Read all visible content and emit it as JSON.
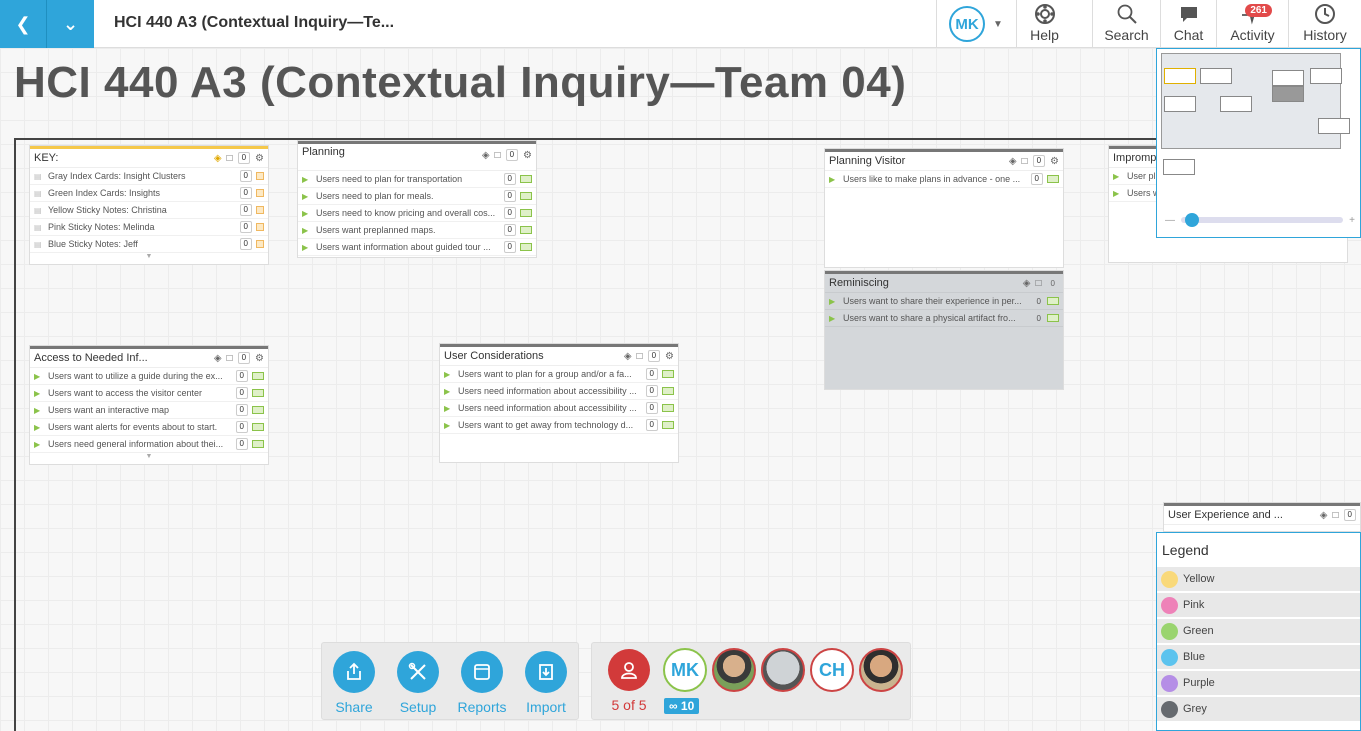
{
  "topbar": {
    "doc_title": "HCI 440 A3 (Contextual Inquiry—Te...",
    "user_initials": "MK",
    "tools": [
      {
        "label": "Help",
        "icon": "lifebuoy-icon"
      },
      {
        "label": "Search",
        "icon": "search-icon"
      },
      {
        "label": "Chat",
        "icon": "chat-icon"
      },
      {
        "label": "Activity",
        "icon": "activity-icon",
        "badge": "261"
      },
      {
        "label": "History",
        "icon": "history-icon"
      }
    ]
  },
  "page_title": "HCI 440 A3 (Contextual Inquiry—Team 04)",
  "cards": {
    "key": {
      "title": "KEY:",
      "count": "0",
      "rows": [
        {
          "text": "Gray Index Cards: Insight Clusters",
          "count": "0"
        },
        {
          "text": "Green Index Cards: Insights",
          "count": "0"
        },
        {
          "text": "Yellow Sticky Notes: Christina",
          "count": "0"
        },
        {
          "text": "Pink Sticky Notes: Melinda",
          "count": "0"
        },
        {
          "text": "Blue Sticky Notes: Jeff",
          "count": "0"
        }
      ]
    },
    "planning": {
      "title": "Planning",
      "count": "0",
      "rows": [
        {
          "text": "Users need to plan for transportation",
          "count": "0"
        },
        {
          "text": "Users need to plan for meals.",
          "count": "0"
        },
        {
          "text": "Users need to know pricing and overall cos...",
          "count": "0"
        },
        {
          "text": "Users want preplanned maps.",
          "count": "0"
        },
        {
          "text": "Users want information about guided tour ...",
          "count": "0"
        }
      ]
    },
    "planning_visitor": {
      "title": "Planning Visitor",
      "count": "0",
      "rows": [
        {
          "text": "Users like to make plans in advance - one ...",
          "count": "0"
        }
      ]
    },
    "impromptu": {
      "title": "Impromp",
      "rows": [
        {
          "text": "User pl"
        },
        {
          "text": "Users w"
        }
      ]
    },
    "reminiscing": {
      "title": "Reminiscing",
      "count": "0",
      "rows": [
        {
          "text": "Users want to share their experience in per...",
          "count": "0"
        },
        {
          "text": "Users want to share a physical artifact fro...",
          "count": "0"
        }
      ]
    },
    "access": {
      "title": "Access to Needed Inf...",
      "count": "0",
      "rows": [
        {
          "text": "Users want to utilize a guide during the ex...",
          "count": "0"
        },
        {
          "text": "Users want to access the visitor center",
          "count": "0"
        },
        {
          "text": "Users want an interactive map",
          "count": "0"
        },
        {
          "text": "Users want alerts for events about to start.",
          "count": "0"
        },
        {
          "text": "Users need general information about thei...",
          "count": "0"
        }
      ]
    },
    "user_considerations": {
      "title": "User Considerations",
      "count": "0",
      "rows": [
        {
          "text": "Users want to plan for a group and/or a fa...",
          "count": "0"
        },
        {
          "text": "Users need information about accessibility ...",
          "count": "0"
        },
        {
          "text": "Users need information about accessibility ...",
          "count": "0"
        },
        {
          "text": "Users want to get away from technology d...",
          "count": "0"
        }
      ]
    },
    "user_experience": {
      "title": "User Experience and ...",
      "count": "0"
    }
  },
  "legend": {
    "title": "Legend",
    "items": [
      {
        "label": "Yellow",
        "color": "#f9d97a"
      },
      {
        "label": "Pink",
        "color": "#ee82b8"
      },
      {
        "label": "Green",
        "color": "#9ad46f"
      },
      {
        "label": "Blue",
        "color": "#5cc3ee"
      },
      {
        "label": "Purple",
        "color": "#b58ee6"
      },
      {
        "label": "Grey",
        "color": "#666a6f"
      }
    ]
  },
  "actions": [
    {
      "label": "Share",
      "icon": "share-icon"
    },
    {
      "label": "Setup",
      "icon": "tools-icon"
    },
    {
      "label": "Reports",
      "icon": "reports-icon"
    },
    {
      "label": "Import",
      "icon": "import-icon"
    }
  ],
  "people": {
    "count_label": "5 of 5",
    "viewers": "10",
    "avatars": [
      {
        "initials": "MK"
      },
      {
        "initials": ""
      },
      {
        "initials": ""
      },
      {
        "initials": "CH"
      },
      {
        "initials": ""
      }
    ]
  },
  "colors": {
    "accent": "#2fa5da",
    "danger": "#d23a3a",
    "insight_green": "#8bc34a"
  }
}
